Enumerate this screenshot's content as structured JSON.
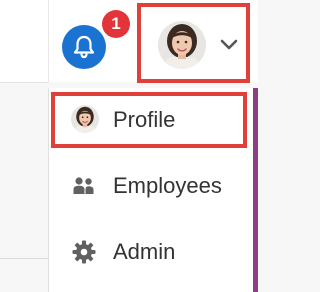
{
  "header": {
    "notifications": {
      "icon": "bell-icon",
      "count": "1",
      "accent": "#1a73d1",
      "badge_color": "#e3343a"
    },
    "profile_trigger": {
      "avatar": "user-avatar",
      "dropdown_icon": "chevron-down-icon",
      "highlight_color": "#e0403a"
    }
  },
  "menu": {
    "items": [
      {
        "label": "Profile",
        "icon": "user-avatar-icon",
        "highlighted": true
      },
      {
        "label": "Employees",
        "icon": "people-icon"
      },
      {
        "label": "Admin",
        "icon": "gear-icon"
      }
    ]
  }
}
